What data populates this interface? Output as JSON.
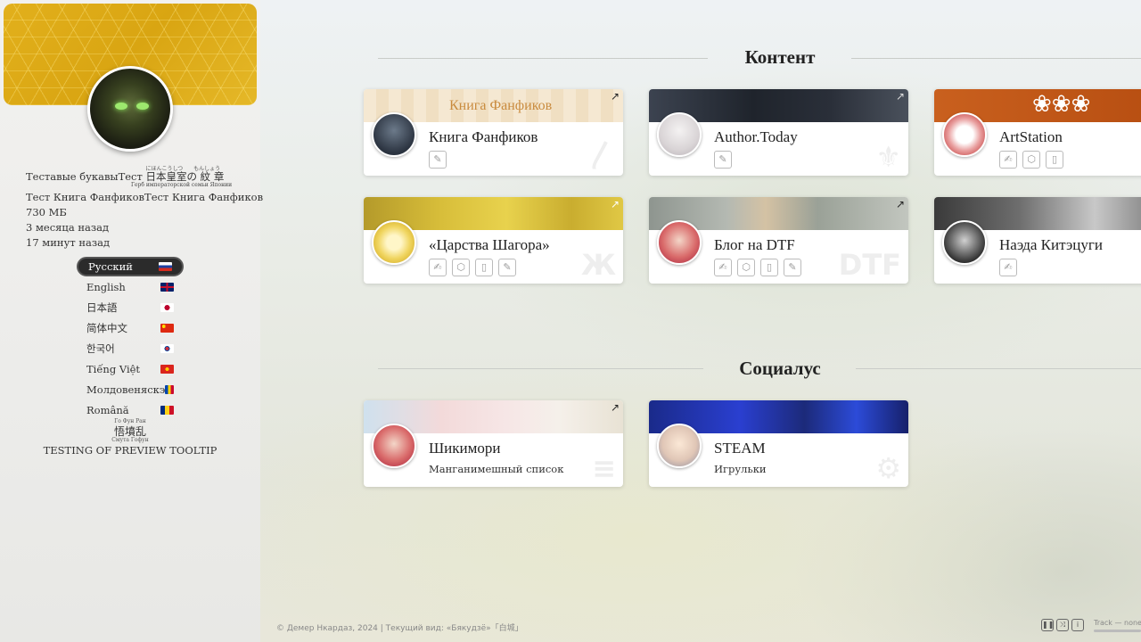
{
  "sidebar": {
    "info": {
      "test_prefix": "Теставые букавыТест",
      "kanji": "日本皇室の 紋 章",
      "kanji_ruby": "にほんこうしつ　　もんしょう",
      "kanji_sub": "Герб императорской семьи Японии",
      "book_line": "Тест Книга ФанфиковТест Книга Фанфиков",
      "size": "730  МБ",
      "months": "3  месяца назад",
      "minutes": "17  минут назад"
    },
    "languages": [
      {
        "label": "Русский",
        "flag": "ru"
      },
      {
        "label": "English",
        "flag": "gb"
      },
      {
        "label": "日本語",
        "flag": "jp"
      },
      {
        "label": "简体中文",
        "flag": "cn"
      },
      {
        "label": "한국어",
        "flag": "kr"
      },
      {
        "label": "Tiếng Việt",
        "flag": "vn"
      },
      {
        "label": "Молдовеняскэ",
        "flag": "md"
      },
      {
        "label": "Română",
        "flag": "ro"
      }
    ],
    "extra_ruby": "Го  Фун Ран",
    "extra_chars": "悟墳乱",
    "extra_sub": "Смута Гофун",
    "tooltip_test": "TESTING OF PREVIEW TOOLTIP"
  },
  "sections": {
    "content_title": "Контент",
    "social_title": "Социалус"
  },
  "cards": {
    "fanfics": {
      "name": "Книга Фанфиков",
      "banner_text": "Книга Фанфиков"
    },
    "author_today": {
      "name": "Author.Today"
    },
    "artstation": {
      "name": "ArtStation"
    },
    "shagor": {
      "name": "«Царства Шагора»"
    },
    "dtf": {
      "name": "Блог на DTF",
      "watermark": "DTF"
    },
    "naeda": {
      "name": "Наэда Китэцуги"
    },
    "shikimori": {
      "name": "Шикимори",
      "sub": "Манганимешный список"
    },
    "steam": {
      "name": "STEAM",
      "sub": "Игрульки"
    }
  },
  "footer": {
    "text": "© Демер Нкардаз, 2024  |  Текущий вид: «Бякудзё»「白城」",
    "track": "Track — none"
  },
  "colors": {
    "banner_gold": "#d9a512",
    "active_lang_bg": "#2b2b2b"
  }
}
